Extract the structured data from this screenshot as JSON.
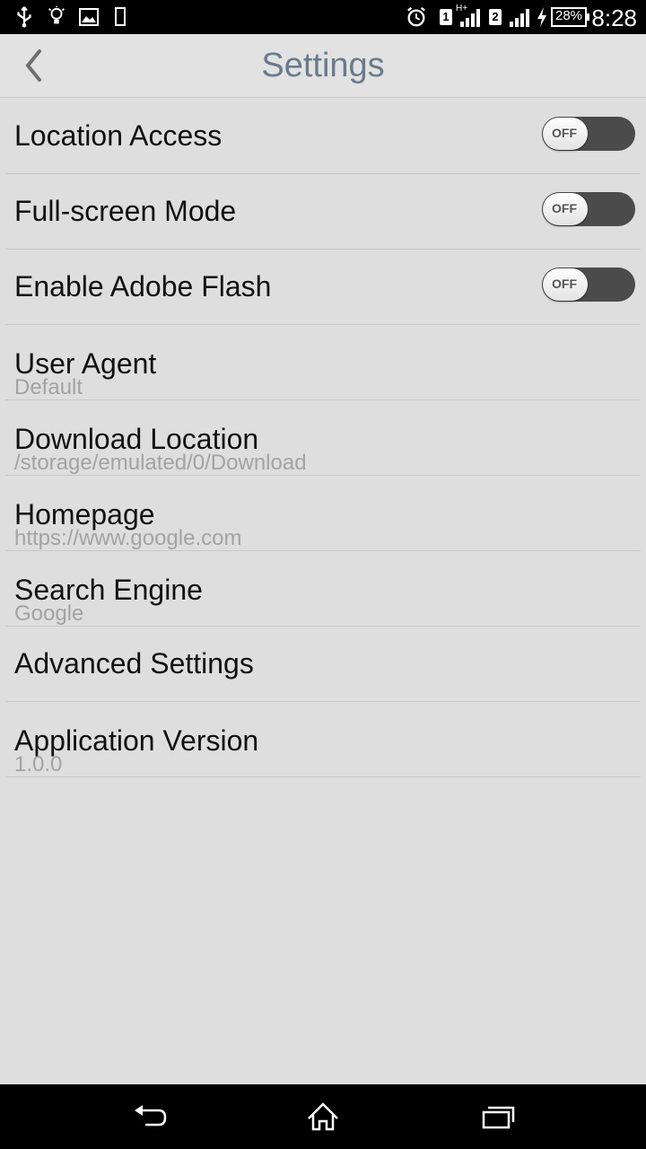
{
  "status_bar": {
    "time": "8:28",
    "battery": "28%",
    "sim1": "1",
    "sim2": "2",
    "network": "H+",
    "icons": [
      "usb-icon",
      "lightbulb-icon",
      "image-icon",
      "phone-icon",
      "alarm-icon",
      "signal-icon",
      "charging-icon",
      "battery-icon"
    ]
  },
  "header": {
    "title": "Settings",
    "back_icon": "chevron-left-icon"
  },
  "settings": {
    "items": [
      {
        "title": "Location Access",
        "toggle": "OFF"
      },
      {
        "title": "Full-screen Mode",
        "toggle": "OFF"
      },
      {
        "title": "Enable Adobe Flash",
        "toggle": "OFF"
      },
      {
        "title": "User Agent",
        "value": "Default"
      },
      {
        "title": "Download Location",
        "value": "/storage/emulated/0/Download"
      },
      {
        "title": "Homepage",
        "value": "https://www.google.com"
      },
      {
        "title": "Search Engine",
        "value": "Google"
      },
      {
        "title": "Advanced Settings"
      },
      {
        "title": "Application Version",
        "value": "1.0.0"
      }
    ]
  },
  "nav": {
    "icons": [
      "back-icon",
      "home-icon",
      "recents-icon"
    ]
  },
  "colors": {
    "background": "#dedede",
    "title": "#6b7a8c",
    "toggle_track": "#4b4b4b",
    "subtext": "#a3a3a3"
  }
}
